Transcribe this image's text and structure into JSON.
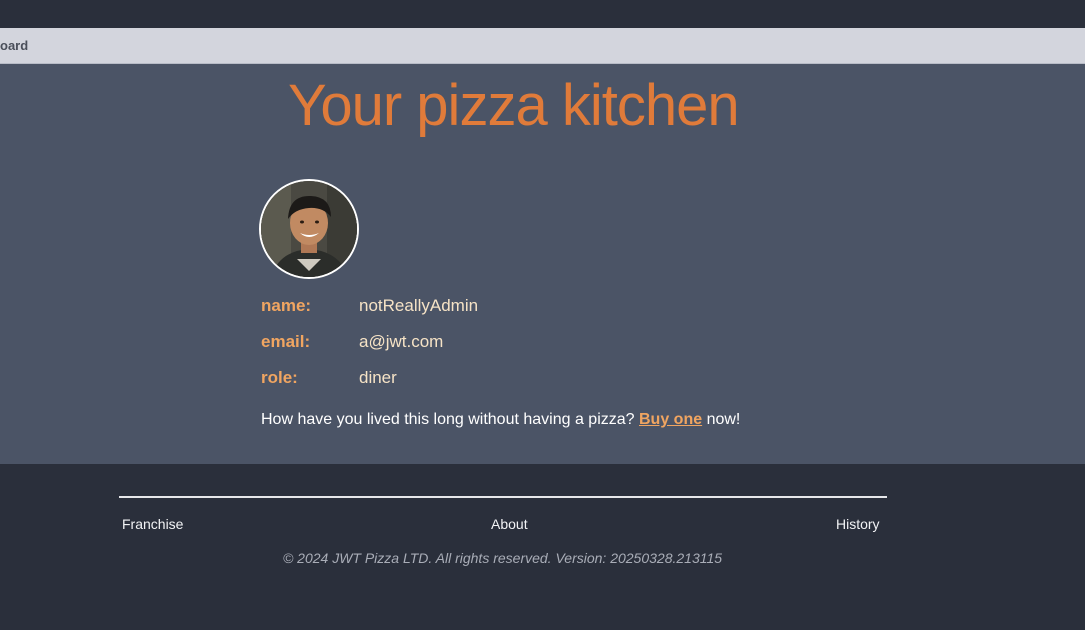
{
  "breadcrumb": {
    "label": "oard"
  },
  "main": {
    "title": "Your pizza kitchen",
    "fields": [
      {
        "label": "name:",
        "value": "notReallyAdmin"
      },
      {
        "label": "email:",
        "value": "a@jwt.com"
      },
      {
        "label": "role:",
        "value": "diner"
      }
    ],
    "cta": {
      "prefix": "How have you lived this long without having a pizza? ",
      "link": "Buy one",
      "suffix": " now!"
    }
  },
  "footer": {
    "links": {
      "franchise": "Franchise",
      "about": "About",
      "history": "History"
    },
    "copyright": "© 2024 JWT Pizza LTD. All rights reserved. Version: 20250328.213115"
  },
  "colors": {
    "accent": "#e07b3a",
    "label": "#f0a561",
    "main_bg": "#4b5466",
    "footer_bg": "#2a2f3b"
  }
}
